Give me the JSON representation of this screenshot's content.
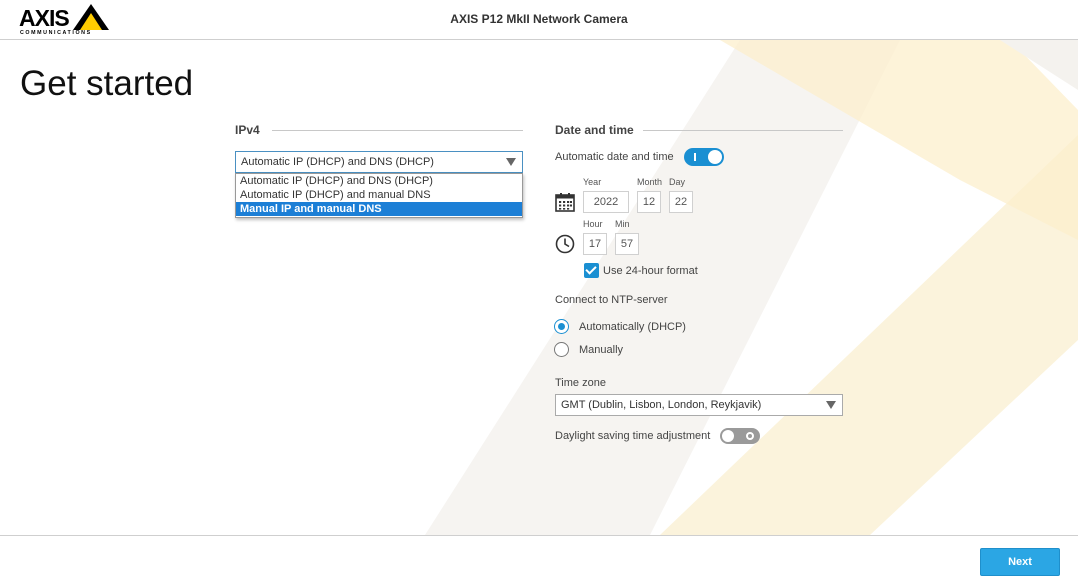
{
  "header": {
    "logo_text": "AXIS",
    "logo_sub": "COMMUNICATIONS",
    "device_title": "AXIS P12 MkII Network Camera"
  },
  "page": {
    "title": "Get started"
  },
  "ipv4": {
    "heading": "IPv4",
    "selected": "Automatic IP (DHCP) and DNS (DHCP)",
    "options": [
      "Automatic IP (DHCP) and DNS (DHCP)",
      "Automatic IP (DHCP) and manual DNS",
      "Manual IP and manual DNS"
    ],
    "highlighted_index": 2
  },
  "datetime": {
    "heading": "Date and time",
    "auto_label": "Automatic date and time",
    "auto_enabled": true,
    "year_label": "Year",
    "month_label": "Month",
    "day_label": "Day",
    "year": "2022",
    "month": "12",
    "day": "22",
    "hour_label": "Hour",
    "min_label": "Min",
    "hour": "17",
    "min": "57",
    "format24_label": "Use 24-hour format",
    "format24_checked": true,
    "ntp_label": "Connect to NTP-server",
    "ntp_options": [
      "Automatically (DHCP)",
      "Manually"
    ],
    "ntp_selected": 0,
    "timezone_label": "Time zone",
    "timezone_value": "GMT (Dublin, Lisbon, London, Reykjavik)",
    "dst_label": "Daylight saving time adjustment",
    "dst_enabled": false
  },
  "footer": {
    "next_label": "Next"
  },
  "colors": {
    "accent": "#1a8fd2",
    "next_button": "#2ba6e4",
    "deco_yellow": "#fdf0cf"
  },
  "icons": {
    "calendar": "calendar-icon",
    "clock": "clock-icon",
    "dropdown": "chevron-down-icon"
  }
}
